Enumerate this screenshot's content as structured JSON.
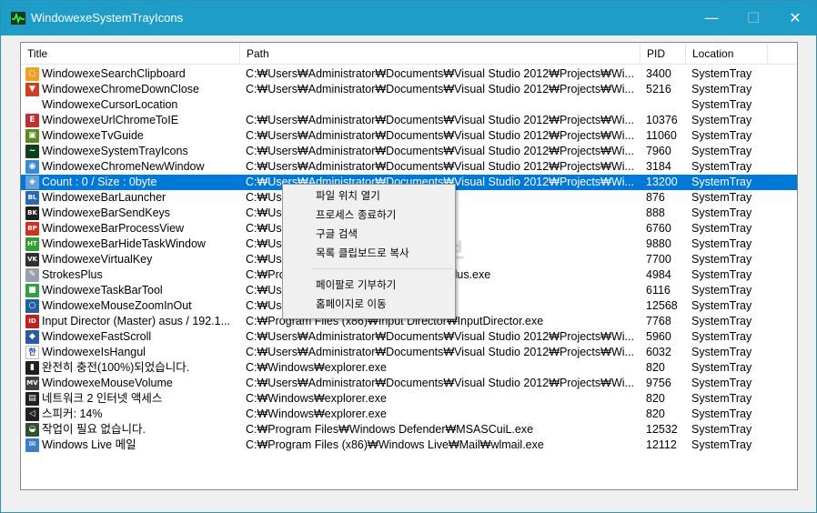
{
  "window": {
    "title": "WindowexeSystemTrayIcons",
    "minimize_glyph": "—",
    "maximize_glyph": "☐",
    "close_glyph": "✕"
  },
  "columns": [
    "Title",
    "Path",
    "PID",
    "Location"
  ],
  "rows": [
    {
      "icon": "magnifier-icon",
      "color": "#f0a020",
      "glyph": "○",
      "title": "WindowexeSearchClipboard",
      "path": "C:₩Users₩Administrator₩Documents₩Visual Studio 2012₩Projects₩Wi...",
      "pid": "3400",
      "location": "SystemTray"
    },
    {
      "icon": "shield-down-icon",
      "color": "#d04020",
      "glyph": "▼",
      "title": "WindowexeChromeDownClose",
      "path": "C:₩Users₩Administrator₩Documents₩Visual Studio 2012₩Projects₩Wi...",
      "pid": "5216",
      "location": "SystemTray"
    },
    {
      "icon": "blank-icon",
      "color": "transparent",
      "glyph": "",
      "title": "WindowexeCursorLocation",
      "path": "",
      "pid": "",
      "location": "SystemTray"
    },
    {
      "icon": "chrome-e-icon",
      "color": "#c03030",
      "glyph": "E",
      "title": "WindowexeUrlChromeToIE",
      "path": "C:₩Users₩Administrator₩Documents₩Visual Studio 2012₩Projects₩Wi...",
      "pid": "10376",
      "location": "SystemTray"
    },
    {
      "icon": "tv-icon",
      "color": "#5a8a20",
      "glyph": "▣",
      "title": "WindowexeTvGuide",
      "path": "C:₩Users₩Administrator₩Documents₩Visual Studio 2012₩Projects₩Wi...",
      "pid": "11060",
      "location": "SystemTray"
    },
    {
      "icon": "pulse-monitor-icon",
      "color": "#10401a",
      "glyph": "~",
      "title": "WindowexeSystemTrayIcons",
      "path": "C:₩Users₩Administrator₩Documents₩Visual Studio 2012₩Projects₩Wi...",
      "pid": "7960",
      "location": "SystemTray"
    },
    {
      "icon": "chrome-new-icon",
      "color": "#3a8ad0",
      "glyph": "◉",
      "title": "WindowexeChromeNewWindow",
      "path": "C:₩Users₩Administrator₩Documents₩Visual Studio 2012₩Projects₩Wi...",
      "pid": "3184",
      "location": "SystemTray"
    },
    {
      "icon": "clipboard-count-icon",
      "color": "#6aa0d8",
      "glyph": "◈",
      "title": "Count : 0 / Size : 0byte",
      "path": "C:₩Users₩Administrator₩Documents₩Visual Studio 2012₩Projects₩Wi...",
      "pid": "13200",
      "location": "SystemTray",
      "selected": true
    },
    {
      "icon": "bl-icon",
      "color": "#2a6ab0",
      "glyph": "BL",
      "title": "WindowexeBarLauncher",
      "path": "C:₩Us",
      "pid": "876",
      "location": "SystemTray"
    },
    {
      "icon": "bk-icon",
      "color": "#202020",
      "glyph": "BK",
      "title": "WindowexeBarSendKeys",
      "path": "C:₩Us",
      "pid": "888",
      "location": "SystemTray"
    },
    {
      "icon": "bp-icon",
      "color": "#d03020",
      "glyph": "BP",
      "title": "WindowexeBarProcessView",
      "path": "C:₩Us",
      "pid": "6760",
      "location": "SystemTray"
    },
    {
      "icon": "ht-icon",
      "color": "#30a030",
      "glyph": "HT",
      "title": "WindowexeBarHideTaskWindow",
      "path": "C:₩Us",
      "pid": "9880",
      "location": "SystemTray"
    },
    {
      "icon": "vk-icon",
      "color": "#303030",
      "glyph": "VK",
      "title": "WindowexeVirtualKey",
      "path": "C:₩Us",
      "pid": "7700",
      "location": "SystemTray"
    },
    {
      "icon": "strokesplus-icon",
      "color": "#9aa0a8",
      "glyph": "✎",
      "title": "StrokesPlus",
      "path": "C:₩Pro",
      "path_tail": "sPlus.exe",
      "pid": "4984",
      "location": "SystemTray"
    },
    {
      "icon": "taskbar-tool-icon",
      "color": "#30a040",
      "glyph": "■",
      "title": "WindowexeTaskBarTool",
      "path": "C:₩Us",
      "pid": "6116",
      "location": "SystemTray"
    },
    {
      "icon": "zoom-icon",
      "color": "#2060a0",
      "glyph": "○",
      "title": "WindowexeMouseZoomInOut",
      "path": "C:₩Us",
      "pid": "12568",
      "location": "SystemTray"
    },
    {
      "icon": "input-director-icon",
      "color": "#c02020",
      "glyph": "ID",
      "title": "Input Director (Master) asus / 192.1...",
      "path": "C:₩Program Files (x86)₩Input Director₩InputDirector.exe",
      "pid": "7768",
      "location": "SystemTray"
    },
    {
      "icon": "fast-scroll-icon",
      "color": "#2a5aa0",
      "glyph": "◆",
      "title": "WindowexeFastScroll",
      "path": "C:₩Users₩Administrator₩Documents₩Visual Studio 2012₩Projects₩Wi...",
      "pid": "5960",
      "location": "SystemTray"
    },
    {
      "icon": "hangul-icon",
      "color": "#ffffff",
      "glyph": "한",
      "title": "WindowexeIsHangul",
      "path": "C:₩Users₩Administrator₩Documents₩Visual Studio 2012₩Projects₩Wi...",
      "pid": "6032",
      "location": "SystemTray"
    },
    {
      "icon": "battery-icon",
      "color": "#202020",
      "glyph": "▮",
      "title": "완전히 충전(100%)되었습니다.",
      "path": "C:₩Windows₩explorer.exe",
      "pid": "820",
      "location": "SystemTray"
    },
    {
      "icon": "mouse-volume-icon",
      "color": "#404040",
      "glyph": "MV",
      "title": "WindowexeMouseVolume",
      "path": "C:₩Users₩Administrator₩Documents₩Visual Studio 2012₩Projects₩Wi...",
      "pid": "9756",
      "location": "SystemTray"
    },
    {
      "icon": "network-icon",
      "color": "#202020",
      "glyph": "▤",
      "title": "네트워크 2 인터넷 액세스",
      "path": "C:₩Windows₩explorer.exe",
      "pid": "820",
      "location": "SystemTray"
    },
    {
      "icon": "speaker-icon",
      "color": "#202020",
      "glyph": "◁",
      "title": "스피커: 14%",
      "path": "C:₩Windows₩explorer.exe",
      "pid": "820",
      "location": "SystemTray"
    },
    {
      "icon": "defender-shield-icon",
      "color": "#305030",
      "glyph": "◒",
      "title": "작업이 필요 없습니다.",
      "path": "C:₩Program Files₩Windows Defender₩MSASCuiL.exe",
      "pid": "12532",
      "location": "SystemTray"
    },
    {
      "icon": "live-mail-icon",
      "color": "#3a80c8",
      "glyph": "✉",
      "title": "Windows Live 메일",
      "path": "C:₩Program Files (x86)₩Windows Live₩Mail₩wlmail.exe",
      "pid": "12112",
      "location": "SystemTray"
    }
  ],
  "context_menu": {
    "items": [
      "파일 위치 열기",
      "프로세스 종료하기",
      "구글 검색",
      "목록 클립보드로 복사",
      "페이팔로 기부하기",
      "홈페이지로 이동"
    ]
  },
  "watermark": "컴퓨터 관련 정보",
  "colors": {
    "titlebar": "#1d9dc8",
    "selection": "#0078d7"
  }
}
